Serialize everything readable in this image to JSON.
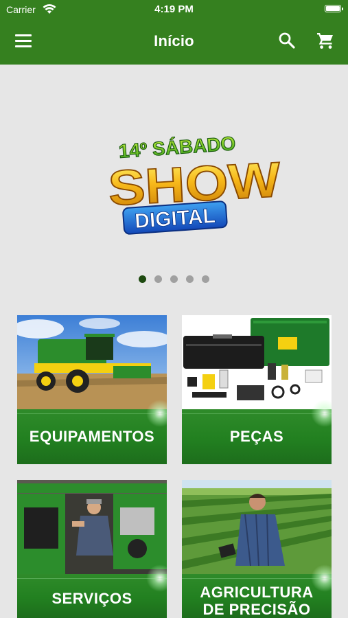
{
  "status_bar": {
    "carrier": "Carrier",
    "time": "4:19 PM"
  },
  "app_bar": {
    "title": "Início",
    "menu_icon": "hamburger-menu-icon",
    "search_icon": "search-icon",
    "cart_icon": "shopping-cart-icon"
  },
  "banner": {
    "line1": "14º SÁBADO",
    "line2": "SHOW",
    "line3": "DIGITAL",
    "dots_total": 5,
    "active_index": 0
  },
  "categories": [
    {
      "label": "EQUIPAMENTOS"
    },
    {
      "label": "PEÇAS"
    },
    {
      "label": "SERVIÇOS"
    },
    {
      "label_line1": "AGRICULTURA",
      "label_line2": "DE PRECISÃO"
    }
  ],
  "colors": {
    "brand_green": "#35801f",
    "active_dot": "#1e4a10",
    "inactive_dot": "#a0a0a0",
    "card_band": "#228020"
  }
}
